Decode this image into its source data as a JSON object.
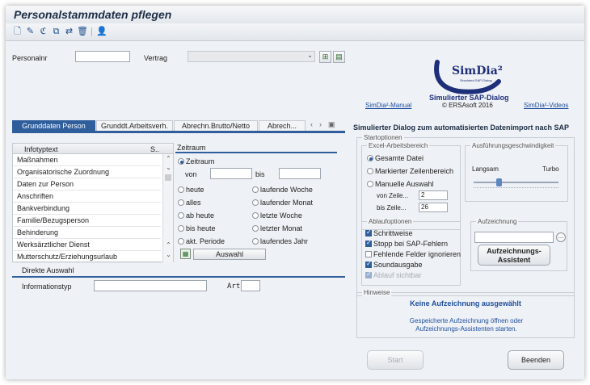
{
  "window": {
    "title": "Personalstammdaten pflegen"
  },
  "toolbar": {
    "icons": [
      "new-icon",
      "edit-icon",
      "display-icon",
      "copy-icon",
      "transfer-icon",
      "delete-icon",
      "user-icon"
    ]
  },
  "header": {
    "personalnr_label": "Personalnr",
    "personalnr_value": "",
    "vertrag_label": "Vertrag",
    "vertrag_value": ""
  },
  "simdia": {
    "logo_text": "SimDia²",
    "logo_sub": "Simulated SAP-Dialog",
    "title": "Simulierter SAP-Dialog",
    "copyright": "© ERSAsoft 2016",
    "manual_link": "SimDia²-Manual",
    "videos_link": "SimDia²-Videos",
    "heading": "Simulierter Dialog zum automatisierten Datenimport nach SAP"
  },
  "tabs": [
    {
      "label": "Grunddaten Person",
      "active": true
    },
    {
      "label": "Grunddt.Arbeitsverh.",
      "active": false
    },
    {
      "label": "Abrechn.Brutto/Netto",
      "active": false
    },
    {
      "label": "Abrech...",
      "active": false
    }
  ],
  "infotypes": {
    "col1": "Infotyptext",
    "col2": "S..",
    "rows": [
      "Maßnahmen",
      "Organisatorische Zuordnung",
      "Daten zur Person",
      "Anschriften",
      "Bankverbindung",
      "Familie/Bezugsperson",
      "Behinderung",
      "Werksärztlicher Dienst",
      "Mutterschutz/Erziehungsurlaub"
    ]
  },
  "zeitraum": {
    "title": "Zeitraum",
    "zeitraum_label": "Zeitraum",
    "von_label": "von",
    "bis_label": "bis",
    "options_left": [
      "heute",
      "alles",
      "ab heute",
      "bis heute",
      "akt. Periode"
    ],
    "options_right": [
      "laufende Woche",
      "laufender Monat",
      "letzte Woche",
      "letzter Monat",
      "laufendes Jahr"
    ],
    "auswahl_button": "Auswahl"
  },
  "direkt": {
    "title": "Direkte Auswahl",
    "infotyp_label": "Informationstyp",
    "art_label": "Art"
  },
  "startoptionen": {
    "title": "Startoptionen",
    "excel_title": "Excel-Arbeitsbereich",
    "opt_gesamt": "Gesamte Datei",
    "opt_markiert": "Markierter Zeilenbereich",
    "opt_manuell": "Manuelle Auswahl",
    "von_zeile_label": "von Zeile...",
    "von_zeile_value": "2",
    "bis_zeile_label": "bis Zeile...",
    "bis_zeile_value": "26",
    "speed_title": "Ausführungsgeschwindigkeit",
    "speed_slow": "Langsam",
    "speed_fast": "Turbo",
    "speed_level": 0.3
  },
  "ablauf": {
    "title": "Ablaufoptionen",
    "options": [
      {
        "label": "Schrittweise",
        "checked": true,
        "disabled": false
      },
      {
        "label": "Stopp bei SAP-Fehlern",
        "checked": true,
        "disabled": false
      },
      {
        "label": "Fehlende Felder ignorieren",
        "checked": false,
        "disabled": false
      },
      {
        "label": "Soundausgabe",
        "checked": true,
        "disabled": false
      },
      {
        "label": "Ablauf sichtbar",
        "checked": true,
        "disabled": true
      }
    ]
  },
  "aufzeichnung": {
    "title": "Aufzeichnung",
    "value": "",
    "assistant_button": "Aufzeichnungs-Assistent"
  },
  "hinweise": {
    "title": "Hinweise",
    "headline": "Keine Aufzeichnung ausgewählt",
    "text": "Gespeicherte Aufzeichnung öffnen oder Aufzeichnungs-Assistenten starten."
  },
  "buttons": {
    "start": "Start",
    "beenden": "Beenden"
  },
  "colors": {
    "accent": "#2f5e9c",
    "link": "#1f4f9f",
    "brand": "#1e2f7a",
    "heading": "#1c2d45"
  }
}
